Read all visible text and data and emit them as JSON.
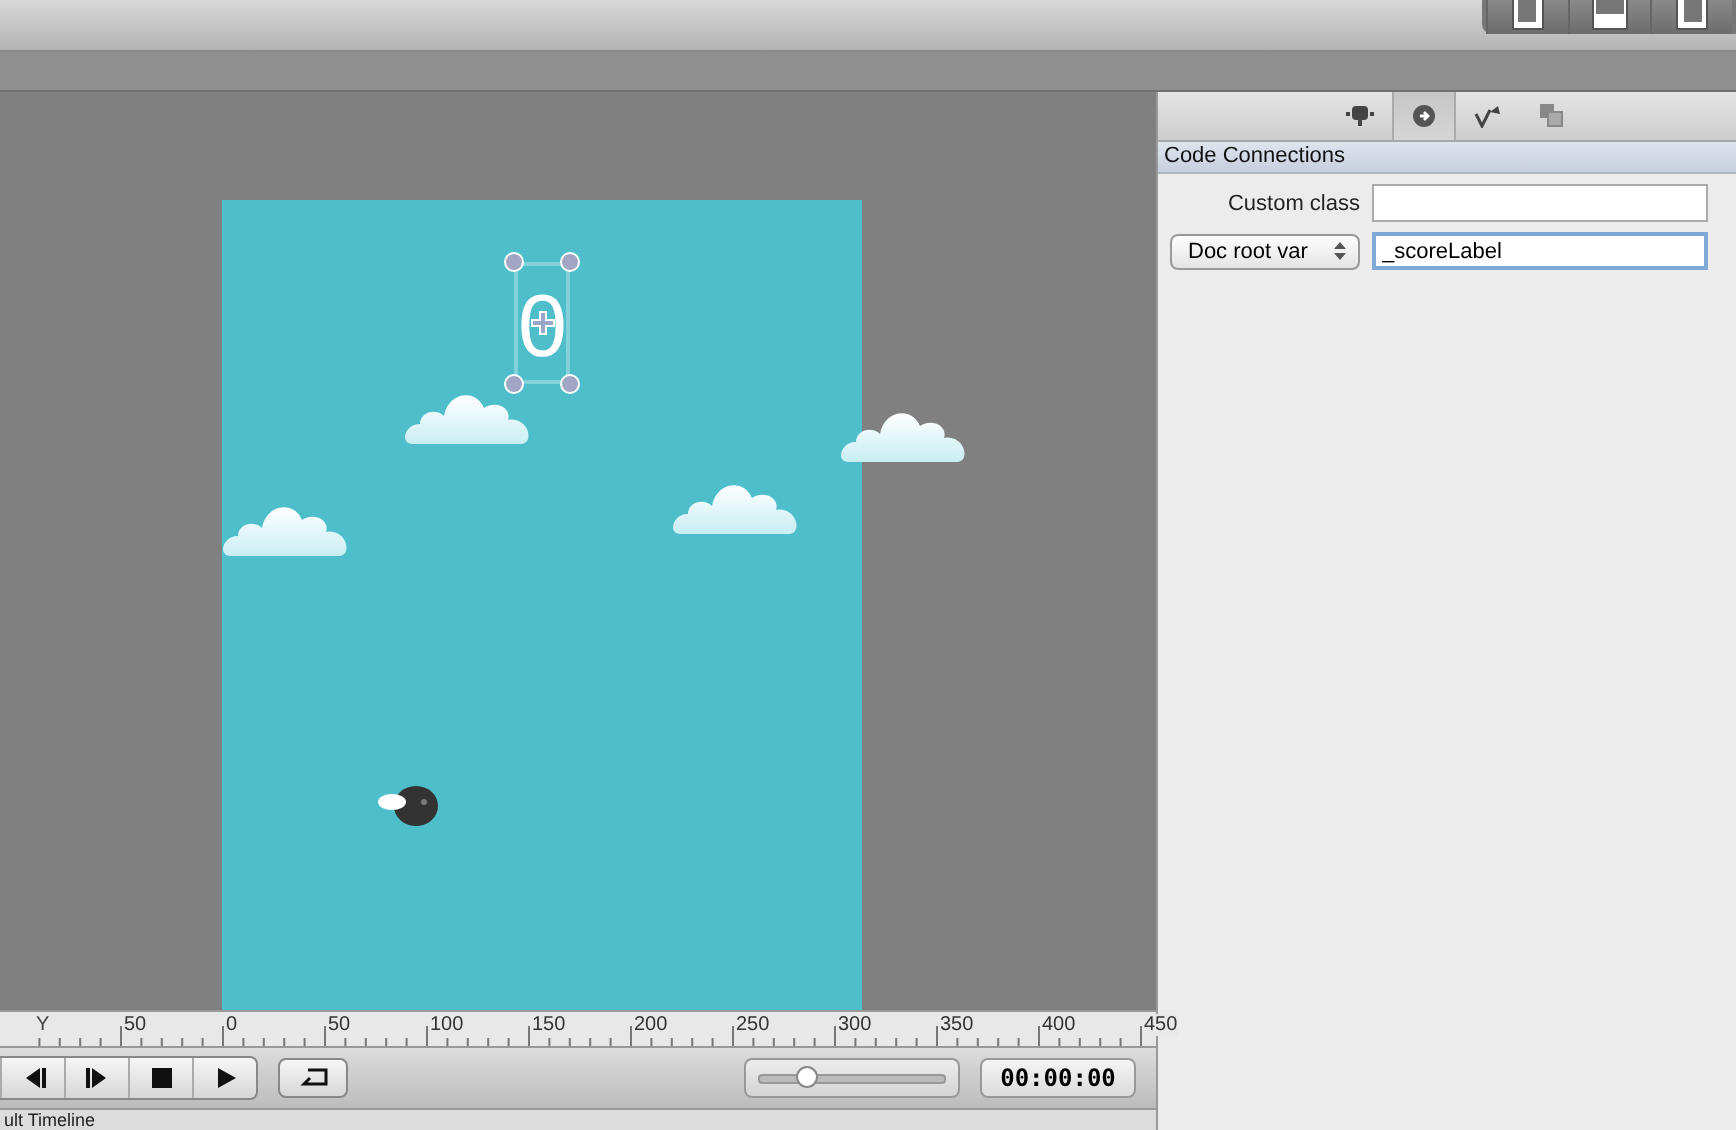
{
  "inspector": {
    "tabs": [
      {
        "kind": "node",
        "selected": false
      },
      {
        "kind": "code",
        "selected": true
      },
      {
        "kind": "pin",
        "selected": false
      },
      {
        "kind": "stack",
        "selected": false
      }
    ],
    "section_title": "Code Connections",
    "custom_class": {
      "label": "Custom class"
    },
    "doc_root": {
      "dropdown": "Doc root var",
      "value": "_scoreLabel",
      "focused": true
    }
  },
  "canvas": {
    "score_label": {
      "text": "0",
      "selected": true
    }
  },
  "toolbar": {
    "panel_toggles": [
      {
        "kind": "left",
        "on": true
      },
      {
        "kind": "bottom",
        "on": true
      },
      {
        "kind": "right",
        "on": true
      }
    ]
  },
  "ruler": {
    "axis_label": "Y",
    "labels": [
      "50",
      "0",
      "50",
      "100",
      "150",
      "200",
      "250",
      "300",
      "350",
      "400",
      "450"
    ]
  },
  "playback": {
    "zoom_slider": {
      "level": 0.25
    },
    "time": "00:00:00"
  },
  "timeline": {
    "title": "ult Timeline"
  }
}
